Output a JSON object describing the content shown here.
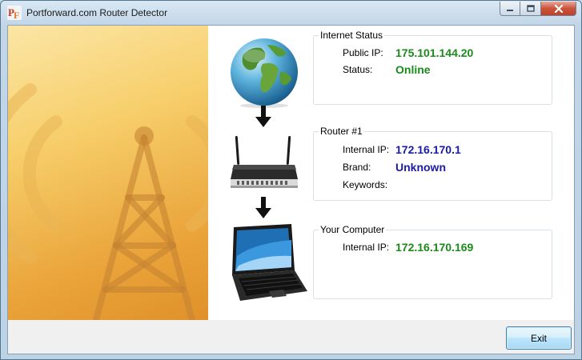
{
  "window": {
    "title": "Portforward.com Router Detector",
    "icon": "pf-app-icon",
    "controls": [
      "minimize-icon",
      "maximize-icon",
      "close-icon"
    ]
  },
  "images": {
    "left_art": "radio-tower-illustration",
    "internet": "globe-icon",
    "router": "router-icon",
    "computer": "laptop-icon",
    "arrows": [
      "down-arrow-icon",
      "down-arrow-icon"
    ]
  },
  "internet_status": {
    "title": "Internet Status",
    "public_ip_label": "Public IP:",
    "public_ip": "175.101.144.20",
    "status_label": "Status:",
    "status": "Online"
  },
  "router": {
    "title": "Router #1",
    "internal_ip_label": "Internal IP:",
    "internal_ip": "172.16.170.1",
    "brand_label": "Brand:",
    "brand": "Unknown",
    "keywords_label": "Keywords:",
    "keywords": ""
  },
  "computer": {
    "title": "Your Computer",
    "internal_ip_label": "Internal IP:",
    "internal_ip": "172.16.170.169"
  },
  "buttons": {
    "exit": "Exit"
  },
  "colors": {
    "value_green": "#1a8a1a",
    "value_blue": "#1a1aa6"
  }
}
